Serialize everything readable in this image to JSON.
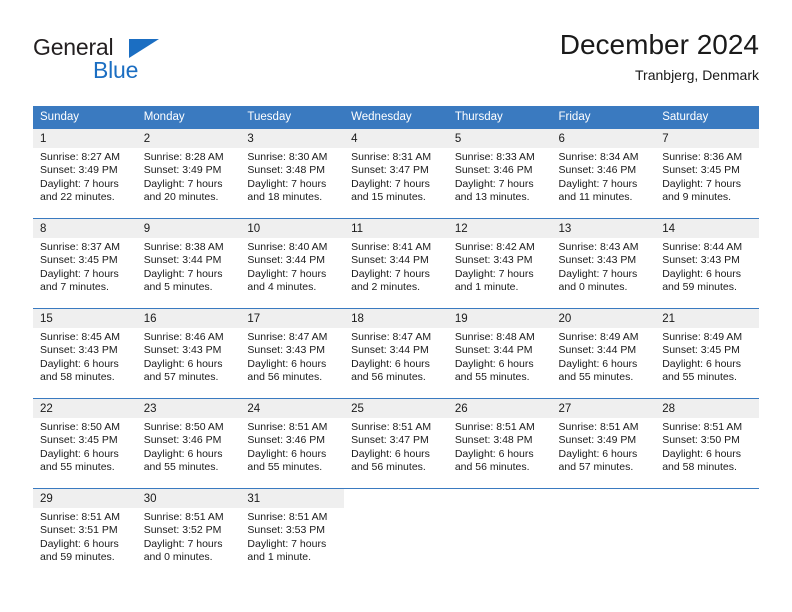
{
  "brand": {
    "name_top": "General",
    "name_bottom": "Blue",
    "triangle_color": "#1b6ec2"
  },
  "header": {
    "title": "December 2024",
    "subtitle": "Tranbjerg, Denmark"
  },
  "theme": {
    "header_blue": "#3a7ac0",
    "daynum_gray": "#efefef",
    "text": "#1a1a1a"
  },
  "calendar": {
    "weekday_headers": [
      "Sunday",
      "Monday",
      "Tuesday",
      "Wednesday",
      "Thursday",
      "Friday",
      "Saturday"
    ],
    "labels": {
      "sunrise": "Sunrise:",
      "sunset": "Sunset:",
      "daylight": "Daylight:"
    },
    "weeks": [
      [
        {
          "day": "1",
          "sunrise": "Sunrise: 8:27 AM",
          "sunset": "Sunset: 3:49 PM",
          "daylight_1": "Daylight: 7 hours",
          "daylight_2": "and 22 minutes."
        },
        {
          "day": "2",
          "sunrise": "Sunrise: 8:28 AM",
          "sunset": "Sunset: 3:49 PM",
          "daylight_1": "Daylight: 7 hours",
          "daylight_2": "and 20 minutes."
        },
        {
          "day": "3",
          "sunrise": "Sunrise: 8:30 AM",
          "sunset": "Sunset: 3:48 PM",
          "daylight_1": "Daylight: 7 hours",
          "daylight_2": "and 18 minutes."
        },
        {
          "day": "4",
          "sunrise": "Sunrise: 8:31 AM",
          "sunset": "Sunset: 3:47 PM",
          "daylight_1": "Daylight: 7 hours",
          "daylight_2": "and 15 minutes."
        },
        {
          "day": "5",
          "sunrise": "Sunrise: 8:33 AM",
          "sunset": "Sunset: 3:46 PM",
          "daylight_1": "Daylight: 7 hours",
          "daylight_2": "and 13 minutes."
        },
        {
          "day": "6",
          "sunrise": "Sunrise: 8:34 AM",
          "sunset": "Sunset: 3:46 PM",
          "daylight_1": "Daylight: 7 hours",
          "daylight_2": "and 11 minutes."
        },
        {
          "day": "7",
          "sunrise": "Sunrise: 8:36 AM",
          "sunset": "Sunset: 3:45 PM",
          "daylight_1": "Daylight: 7 hours",
          "daylight_2": "and 9 minutes."
        }
      ],
      [
        {
          "day": "8",
          "sunrise": "Sunrise: 8:37 AM",
          "sunset": "Sunset: 3:45 PM",
          "daylight_1": "Daylight: 7 hours",
          "daylight_2": "and 7 minutes."
        },
        {
          "day": "9",
          "sunrise": "Sunrise: 8:38 AM",
          "sunset": "Sunset: 3:44 PM",
          "daylight_1": "Daylight: 7 hours",
          "daylight_2": "and 5 minutes."
        },
        {
          "day": "10",
          "sunrise": "Sunrise: 8:40 AM",
          "sunset": "Sunset: 3:44 PM",
          "daylight_1": "Daylight: 7 hours",
          "daylight_2": "and 4 minutes."
        },
        {
          "day": "11",
          "sunrise": "Sunrise: 8:41 AM",
          "sunset": "Sunset: 3:44 PM",
          "daylight_1": "Daylight: 7 hours",
          "daylight_2": "and 2 minutes."
        },
        {
          "day": "12",
          "sunrise": "Sunrise: 8:42 AM",
          "sunset": "Sunset: 3:43 PM",
          "daylight_1": "Daylight: 7 hours",
          "daylight_2": "and 1 minute."
        },
        {
          "day": "13",
          "sunrise": "Sunrise: 8:43 AM",
          "sunset": "Sunset: 3:43 PM",
          "daylight_1": "Daylight: 7 hours",
          "daylight_2": "and 0 minutes."
        },
        {
          "day": "14",
          "sunrise": "Sunrise: 8:44 AM",
          "sunset": "Sunset: 3:43 PM",
          "daylight_1": "Daylight: 6 hours",
          "daylight_2": "and 59 minutes."
        }
      ],
      [
        {
          "day": "15",
          "sunrise": "Sunrise: 8:45 AM",
          "sunset": "Sunset: 3:43 PM",
          "daylight_1": "Daylight: 6 hours",
          "daylight_2": "and 58 minutes."
        },
        {
          "day": "16",
          "sunrise": "Sunrise: 8:46 AM",
          "sunset": "Sunset: 3:43 PM",
          "daylight_1": "Daylight: 6 hours",
          "daylight_2": "and 57 minutes."
        },
        {
          "day": "17",
          "sunrise": "Sunrise: 8:47 AM",
          "sunset": "Sunset: 3:43 PM",
          "daylight_1": "Daylight: 6 hours",
          "daylight_2": "and 56 minutes."
        },
        {
          "day": "18",
          "sunrise": "Sunrise: 8:47 AM",
          "sunset": "Sunset: 3:44 PM",
          "daylight_1": "Daylight: 6 hours",
          "daylight_2": "and 56 minutes."
        },
        {
          "day": "19",
          "sunrise": "Sunrise: 8:48 AM",
          "sunset": "Sunset: 3:44 PM",
          "daylight_1": "Daylight: 6 hours",
          "daylight_2": "and 55 minutes."
        },
        {
          "day": "20",
          "sunrise": "Sunrise: 8:49 AM",
          "sunset": "Sunset: 3:44 PM",
          "daylight_1": "Daylight: 6 hours",
          "daylight_2": "and 55 minutes."
        },
        {
          "day": "21",
          "sunrise": "Sunrise: 8:49 AM",
          "sunset": "Sunset: 3:45 PM",
          "daylight_1": "Daylight: 6 hours",
          "daylight_2": "and 55 minutes."
        }
      ],
      [
        {
          "day": "22",
          "sunrise": "Sunrise: 8:50 AM",
          "sunset": "Sunset: 3:45 PM",
          "daylight_1": "Daylight: 6 hours",
          "daylight_2": "and 55 minutes."
        },
        {
          "day": "23",
          "sunrise": "Sunrise: 8:50 AM",
          "sunset": "Sunset: 3:46 PM",
          "daylight_1": "Daylight: 6 hours",
          "daylight_2": "and 55 minutes."
        },
        {
          "day": "24",
          "sunrise": "Sunrise: 8:51 AM",
          "sunset": "Sunset: 3:46 PM",
          "daylight_1": "Daylight: 6 hours",
          "daylight_2": "and 55 minutes."
        },
        {
          "day": "25",
          "sunrise": "Sunrise: 8:51 AM",
          "sunset": "Sunset: 3:47 PM",
          "daylight_1": "Daylight: 6 hours",
          "daylight_2": "and 56 minutes."
        },
        {
          "day": "26",
          "sunrise": "Sunrise: 8:51 AM",
          "sunset": "Sunset: 3:48 PM",
          "daylight_1": "Daylight: 6 hours",
          "daylight_2": "and 56 minutes."
        },
        {
          "day": "27",
          "sunrise": "Sunrise: 8:51 AM",
          "sunset": "Sunset: 3:49 PM",
          "daylight_1": "Daylight: 6 hours",
          "daylight_2": "and 57 minutes."
        },
        {
          "day": "28",
          "sunrise": "Sunrise: 8:51 AM",
          "sunset": "Sunset: 3:50 PM",
          "daylight_1": "Daylight: 6 hours",
          "daylight_2": "and 58 minutes."
        }
      ],
      [
        {
          "day": "29",
          "sunrise": "Sunrise: 8:51 AM",
          "sunset": "Sunset: 3:51 PM",
          "daylight_1": "Daylight: 6 hours",
          "daylight_2": "and 59 minutes."
        },
        {
          "day": "30",
          "sunrise": "Sunrise: 8:51 AM",
          "sunset": "Sunset: 3:52 PM",
          "daylight_1": "Daylight: 7 hours",
          "daylight_2": "and 0 minutes."
        },
        {
          "day": "31",
          "sunrise": "Sunrise: 8:51 AM",
          "sunset": "Sunset: 3:53 PM",
          "daylight_1": "Daylight: 7 hours",
          "daylight_2": "and 1 minute."
        },
        {
          "day": "",
          "sunrise": "",
          "sunset": "",
          "daylight_1": "",
          "daylight_2": ""
        },
        {
          "day": "",
          "sunrise": "",
          "sunset": "",
          "daylight_1": "",
          "daylight_2": ""
        },
        {
          "day": "",
          "sunrise": "",
          "sunset": "",
          "daylight_1": "",
          "daylight_2": ""
        },
        {
          "day": "",
          "sunrise": "",
          "sunset": "",
          "daylight_1": "",
          "daylight_2": ""
        }
      ]
    ]
  }
}
